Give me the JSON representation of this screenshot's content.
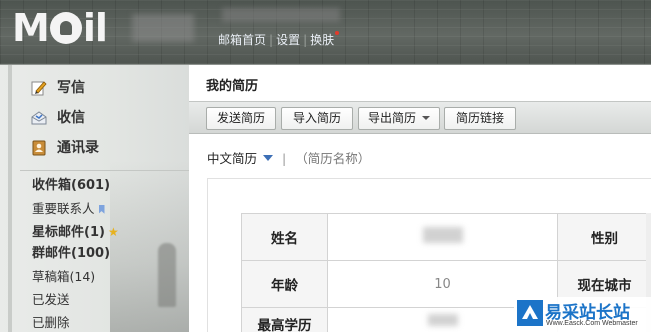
{
  "header": {
    "logo_text": "MOil",
    "nav": {
      "home": "邮箱首页",
      "sep": "|",
      "settings": "设置",
      "skin": "换肤"
    }
  },
  "sidebar": {
    "actions": [
      {
        "label": "写信",
        "icon": "compose-icon"
      },
      {
        "label": "收信",
        "icon": "inbox-receive-icon"
      },
      {
        "label": "通讯录",
        "icon": "contacts-icon"
      }
    ],
    "folders": [
      {
        "label": "收件箱(601)",
        "bold": true
      },
      {
        "label": "重要联系人",
        "bold": false,
        "icon": "bookmark-icon"
      },
      {
        "label": "星标邮件(1)",
        "bold": true,
        "icon": "star-icon"
      },
      {
        "label": "群邮件(100)",
        "bold": true
      },
      {
        "label": "草稿箱(14)",
        "bold": false
      },
      {
        "label": "已发送",
        "bold": false
      },
      {
        "label": "已删除",
        "bold": false
      }
    ]
  },
  "main": {
    "title": "我的简历",
    "toolbar": {
      "send": "发送简历",
      "import": "导入简历",
      "export": "导出简历",
      "link": "简历链接"
    },
    "language": "中文简历",
    "separator": "|",
    "resume_name_placeholder": "（简历名称）",
    "table": {
      "row1": {
        "label1": "姓名",
        "label2": "性别"
      },
      "row2": {
        "label1": "年龄",
        "value1": "10",
        "label2": "现在城市"
      },
      "row3": {
        "label1": "最高学历"
      }
    }
  },
  "watermark": {
    "cn": "易采站长站",
    "en": "Www.Easck.Com Webmaster"
  },
  "colors": {
    "accent_blue": "#3d6fb6",
    "watermark_blue": "#1c74c8",
    "notify_dot": "#e23a2a"
  }
}
